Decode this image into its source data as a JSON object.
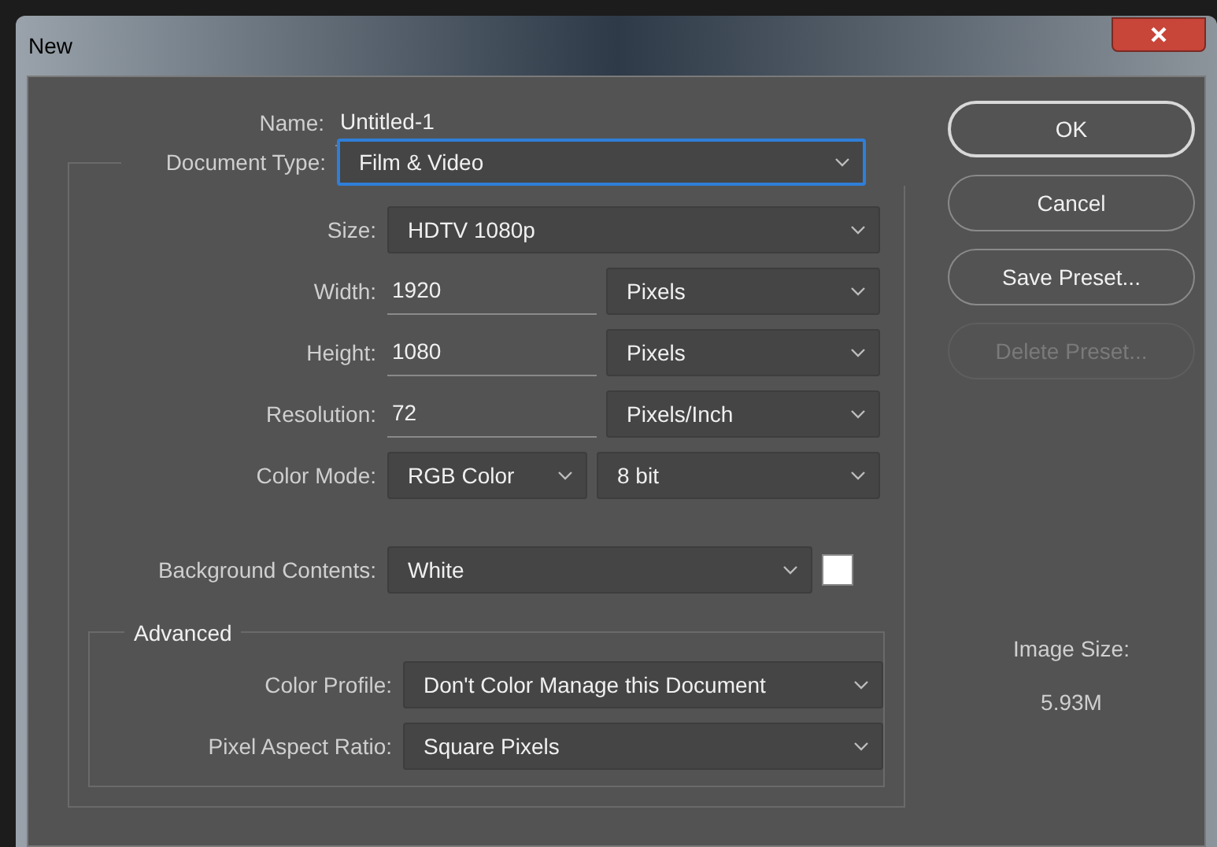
{
  "window": {
    "title": "New"
  },
  "name": {
    "label": "Name:",
    "value": "Untitled-1"
  },
  "document_type": {
    "label": "Document Type:",
    "value": "Film & Video",
    "focused": true
  },
  "fields": [
    {
      "kind": "select",
      "label": "Size:",
      "value": "HDTV 1080p"
    },
    {
      "kind": "text-unit",
      "label": "Width:",
      "value": "1920",
      "unit": "Pixels"
    },
    {
      "kind": "text-unit",
      "label": "Height:",
      "value": "1080",
      "unit": "Pixels"
    },
    {
      "kind": "text-unit",
      "label": "Resolution:",
      "value": "72",
      "unit": "Pixels/Inch"
    },
    {
      "kind": "select-pair",
      "label": "Color Mode:",
      "value": "RGB Color",
      "unit": "8 bit"
    },
    {
      "kind": "select-swatch",
      "label": "Background Contents:",
      "value": "White",
      "color": "#ffffff"
    }
  ],
  "advanced": {
    "title": "Advanced",
    "fields": [
      {
        "kind": "select",
        "label": "Color Profile:",
        "value": "Don't Color Manage this Document"
      },
      {
        "kind": "select",
        "label": "Pixel Aspect Ratio:",
        "value": "Square Pixels"
      }
    ]
  },
  "buttons": [
    {
      "label": "OK",
      "disabled": false,
      "default": true
    },
    {
      "label": "Cancel",
      "disabled": false,
      "default": false
    },
    {
      "label": "Save Preset...",
      "disabled": false,
      "default": false
    },
    {
      "label": "Delete Preset...",
      "disabled": true,
      "default": false
    }
  ],
  "image_size": {
    "label": "Image Size:",
    "value": "5.93M"
  }
}
